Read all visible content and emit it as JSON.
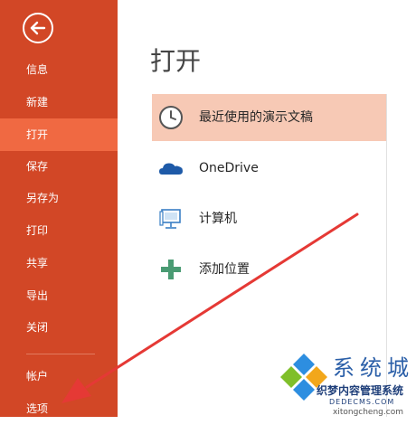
{
  "sidebar": {
    "back_icon": "arrow-left-circle-icon",
    "items": [
      {
        "label": "信息",
        "active": false
      },
      {
        "label": "新建",
        "active": false
      },
      {
        "label": "打开",
        "active": true
      },
      {
        "label": "保存",
        "active": false
      },
      {
        "label": "另存为",
        "active": false
      },
      {
        "label": "打印",
        "active": false
      },
      {
        "label": "共享",
        "active": false
      },
      {
        "label": "导出",
        "active": false
      },
      {
        "label": "关闭",
        "active": false
      }
    ],
    "bottom_items": [
      {
        "label": "帐户"
      },
      {
        "label": "选项"
      }
    ]
  },
  "main": {
    "title": "打开",
    "places": [
      {
        "label": "最近使用的演示文稿",
        "icon": "clock-icon",
        "selected": true
      },
      {
        "label": "OneDrive",
        "icon": "cloud-icon",
        "selected": false
      },
      {
        "label": "计算机",
        "icon": "computer-icon",
        "selected": false
      },
      {
        "label": "添加位置",
        "icon": "plus-icon",
        "selected": false
      }
    ]
  },
  "watermark": {
    "brand": "系统城",
    "chinese": "织梦内容管理系统",
    "domain": "DEDECMS.COM",
    "url": "xitongcheng.com"
  },
  "colors": {
    "sidebar_bg": "#d24726",
    "active_item": "#f06942",
    "selected_place": "#f7c9b5",
    "annotation_arrow": "#e53935"
  }
}
